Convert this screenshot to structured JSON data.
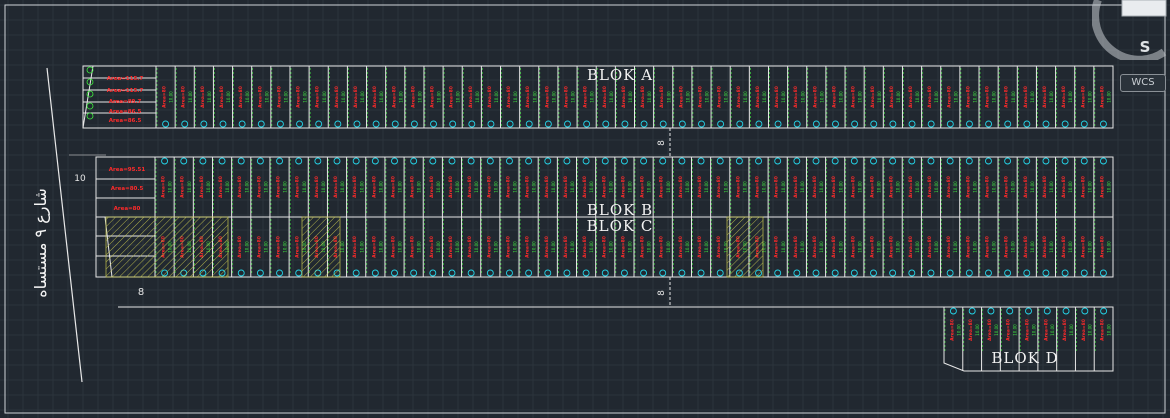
{
  "drawing": {
    "blocks": [
      {
        "id": "A",
        "label": "BLOK  A"
      },
      {
        "id": "B",
        "label": "BLOK  B"
      },
      {
        "id": "C",
        "label": "BLOK  C"
      },
      {
        "id": "D",
        "label": "BLOK  D"
      }
    ],
    "dimension_labels": {
      "left_offset": "10",
      "road_width_bottom": "8",
      "road_width_mid_a": "8",
      "road_width_mid_b": "8"
    },
    "street_name": "شارع ٩ مستساه",
    "block_a_area_labels": [
      "Area=115.7",
      "Area=89.7",
      "Area=86.5",
      "Area=86.5"
    ],
    "block_b_area_labels": [
      "Area=95.51",
      "Area=80.5",
      "Area=80"
    ],
    "plot_text": "Area=80",
    "plot_dim": "10.00"
  },
  "viewcube": {
    "face_label": "S",
    "coord_system": "WCS"
  },
  "colors": {
    "background": "#212830",
    "grid": "#2c343c",
    "lines": "#e8e8e8",
    "plot_text": "#ff2a2a",
    "dims": "#3ef03e",
    "numbers": "#24d4e8",
    "hatch": "#c8c850"
  }
}
